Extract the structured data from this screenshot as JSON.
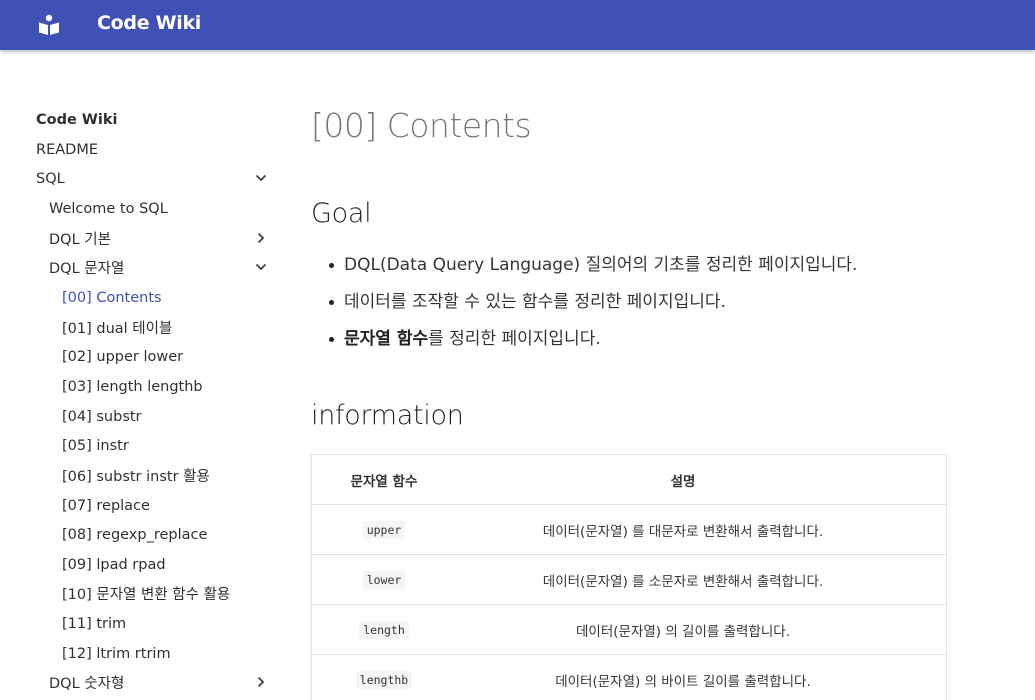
{
  "header": {
    "site_title": "Code Wiki",
    "logo_icon": "book-reader-icon",
    "color": "#3f51b5"
  },
  "sidebar": {
    "title": "Code Wiki",
    "items": [
      {
        "label": "README"
      },
      {
        "label": "SQL",
        "chevron": "down"
      },
      {
        "label": "Welcome to SQL"
      },
      {
        "label": "DQL 기본",
        "chevron": "right"
      },
      {
        "label": "DQL 문자열",
        "chevron": "down"
      },
      {
        "label": "[00] Contents",
        "active": true
      },
      {
        "label": "[01] dual 테이블"
      },
      {
        "label": "[02] upper lower"
      },
      {
        "label": "[03] length lengthb"
      },
      {
        "label": "[04] substr"
      },
      {
        "label": "[05] instr"
      },
      {
        "label": "[06] substr instr 활용"
      },
      {
        "label": "[07] replace"
      },
      {
        "label": "[08] regexp_replace"
      },
      {
        "label": "[09] lpad rpad"
      },
      {
        "label": "[10] 문자열 변환 함수 활용"
      },
      {
        "label": "[11] trim"
      },
      {
        "label": "[12] ltrim rtrim"
      },
      {
        "label": "DQL 숫자형",
        "chevron": "right"
      }
    ],
    "active_color": "#3f51b5"
  },
  "main": {
    "title": "[00] Contents",
    "goal_heading": "Goal",
    "goals": [
      {
        "text": "DQL(Data Query Language) 질의어의 기초를 정리한 페이지입니다."
      },
      {
        "text": "데이터를 조작할 수 있는 함수를 정리한 페이지입니다."
      },
      {
        "bold": "문자열 함수",
        "text": "를 정리한 페이지입니다."
      }
    ],
    "info_heading": "information",
    "table": {
      "headers": [
        "문자열 함수",
        "설명"
      ],
      "rows": [
        {
          "func": "upper",
          "desc": "데이터(문자열) 를 대문자로 변환해서 출력합니다."
        },
        {
          "func": "lower",
          "desc": "데이터(문자열) 를 소문자로 변환해서 출력합니다."
        },
        {
          "func": "length",
          "desc": "데이터(문자열) 의 길이를 출력합니다."
        },
        {
          "func": "lengthb",
          "desc": "데이터(문자열) 의 바이트 길이를 출력합니다."
        }
      ]
    }
  }
}
